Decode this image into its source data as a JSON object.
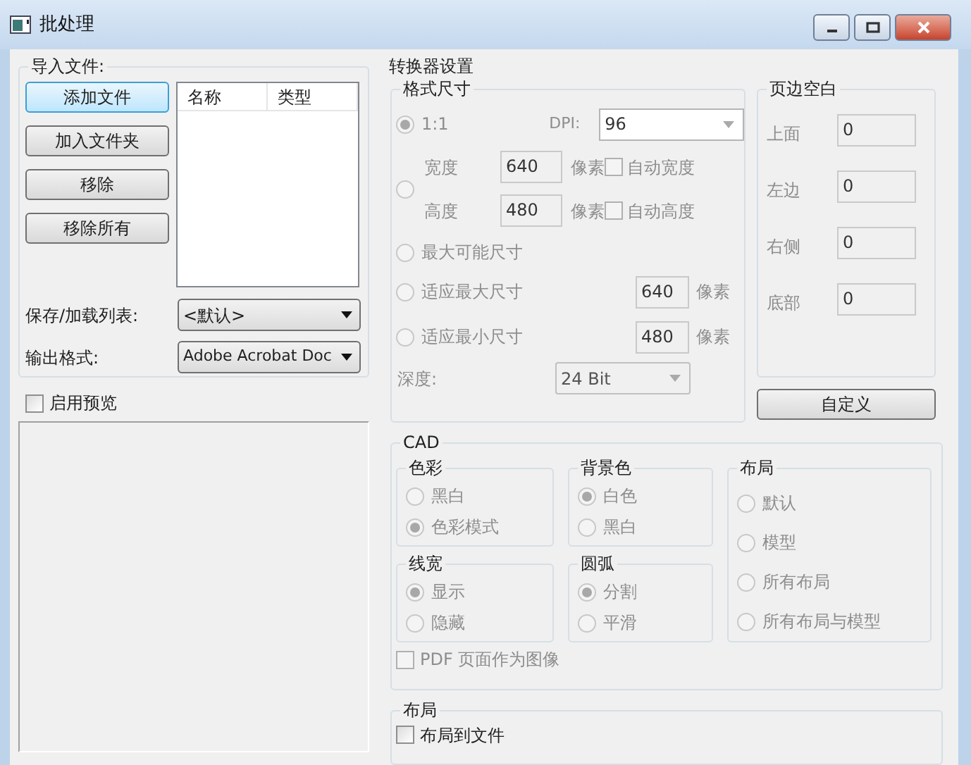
{
  "window": {
    "title": "批处理"
  },
  "import_files": {
    "title": "导入文件:",
    "buttons": [
      {
        "label": "添加文件",
        "focused": true
      },
      {
        "label": "加入文件夹",
        "focused": false
      },
      {
        "label": "移除",
        "focused": false
      },
      {
        "label": "移除所有",
        "focused": false
      }
    ],
    "file_list": {
      "columns": [
        "名称",
        "类型"
      ]
    }
  },
  "save_load_list": {
    "label": "保存/加载列表:",
    "value": "<默认>"
  },
  "output_format": {
    "label": "输出格式:",
    "value": "Adobe Acrobat Doc"
  },
  "enable_preview": {
    "label": "启用预览",
    "checked": false
  },
  "converter_settings": {
    "title": "转换器设置",
    "format_size": {
      "title": "格式尺寸",
      "disabled": true,
      "one_to_one": {
        "label": "1:1",
        "selected": true
      },
      "dpi": {
        "label": "DPI:",
        "value": "96"
      },
      "custom": {
        "selected": false,
        "width": {
          "label": "宽度",
          "value": "640",
          "unit": "像素",
          "auto_label": "自动宽度",
          "auto_checked": false
        },
        "height": {
          "label": "高度",
          "value": "480",
          "unit": "像素",
          "auto_label": "自动高度",
          "auto_checked": false
        }
      },
      "max_possible": {
        "label": "最大可能尺寸",
        "selected": false
      },
      "fit_max": {
        "label": "适应最大尺寸",
        "selected": false,
        "value": "640",
        "unit": "像素"
      },
      "fit_min": {
        "label": "适应最小尺寸",
        "selected": false,
        "value": "480",
        "unit": "像素"
      },
      "depth": {
        "label": "深度:",
        "value": "24 Bit"
      }
    },
    "margins": {
      "title": "页边空白",
      "disabled": true,
      "fields": [
        {
          "label": "上面",
          "value": "0"
        },
        {
          "label": "左边",
          "value": "0"
        },
        {
          "label": "右侧",
          "value": "0"
        },
        {
          "label": "底部",
          "value": "0"
        }
      ]
    },
    "custom_button": "自定义"
  },
  "cad": {
    "title": "CAD",
    "disabled": true,
    "groups": [
      {
        "title": "色彩",
        "options": [
          {
            "label": "黑白",
            "selected": false
          },
          {
            "label": "色彩模式",
            "selected": true
          }
        ]
      },
      {
        "title": "背景色",
        "options": [
          {
            "label": "白色",
            "selected": true
          },
          {
            "label": "黑白",
            "selected": false
          }
        ]
      },
      {
        "title": "线宽",
        "options": [
          {
            "label": "显示",
            "selected": true
          },
          {
            "label": "隐藏",
            "selected": false
          }
        ]
      },
      {
        "title": "圆弧",
        "options": [
          {
            "label": "分割",
            "selected": true
          },
          {
            "label": "平滑",
            "selected": false
          }
        ]
      }
    ],
    "layout": {
      "title": "布局",
      "options": [
        {
          "label": "默认",
          "selected": false
        },
        {
          "label": "模型",
          "selected": false
        },
        {
          "label": "所有布局",
          "selected": false
        },
        {
          "label": "所有布局与模型",
          "selected": false
        }
      ]
    },
    "pdf_as_image": {
      "label": "PDF 页面作为图像",
      "checked": false
    }
  },
  "layout_section": {
    "title": "布局",
    "layout_to_file": {
      "label": "布局到文件",
      "checked": false
    }
  }
}
